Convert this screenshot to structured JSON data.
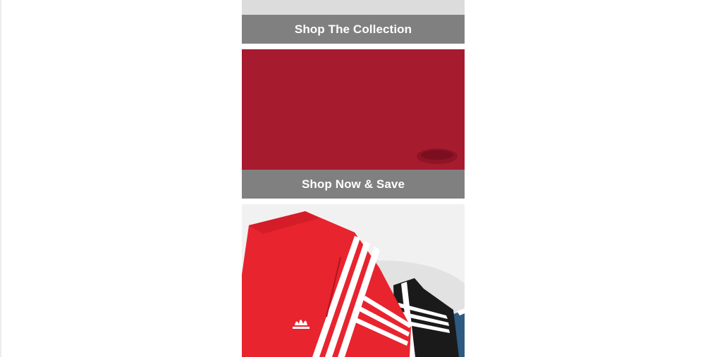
{
  "promos": [
    {
      "cta_label": "Shop The Collection",
      "image_icon": "product-image-placeholder"
    },
    {
      "cta_label": "Shop Now & Save",
      "image_icon": "red-banner-image",
      "image_color": "#a71b2f"
    },
    {
      "image_icon": "track-pants-image",
      "colors": {
        "red": "#e8242f",
        "black": "#1a1a1a",
        "blue": "#2d5a80"
      }
    }
  ]
}
